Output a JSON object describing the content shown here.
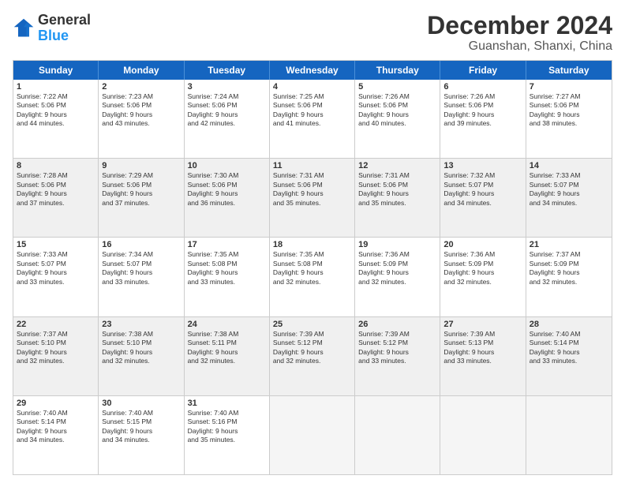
{
  "logo": {
    "line1": "General",
    "line2": "Blue"
  },
  "header": {
    "month": "December 2024",
    "location": "Guanshan, Shanxi, China"
  },
  "days": [
    "Sunday",
    "Monday",
    "Tuesday",
    "Wednesday",
    "Thursday",
    "Friday",
    "Saturday"
  ],
  "weeks": [
    [
      {
        "num": "1",
        "lines": [
          "Sunrise: 7:22 AM",
          "Sunset: 5:06 PM",
          "Daylight: 9 hours",
          "and 44 minutes."
        ]
      },
      {
        "num": "2",
        "lines": [
          "Sunrise: 7:23 AM",
          "Sunset: 5:06 PM",
          "Daylight: 9 hours",
          "and 43 minutes."
        ]
      },
      {
        "num": "3",
        "lines": [
          "Sunrise: 7:24 AM",
          "Sunset: 5:06 PM",
          "Daylight: 9 hours",
          "and 42 minutes."
        ]
      },
      {
        "num": "4",
        "lines": [
          "Sunrise: 7:25 AM",
          "Sunset: 5:06 PM",
          "Daylight: 9 hours",
          "and 41 minutes."
        ]
      },
      {
        "num": "5",
        "lines": [
          "Sunrise: 7:26 AM",
          "Sunset: 5:06 PM",
          "Daylight: 9 hours",
          "and 40 minutes."
        ]
      },
      {
        "num": "6",
        "lines": [
          "Sunrise: 7:26 AM",
          "Sunset: 5:06 PM",
          "Daylight: 9 hours",
          "and 39 minutes."
        ]
      },
      {
        "num": "7",
        "lines": [
          "Sunrise: 7:27 AM",
          "Sunset: 5:06 PM",
          "Daylight: 9 hours",
          "and 38 minutes."
        ]
      }
    ],
    [
      {
        "num": "8",
        "lines": [
          "Sunrise: 7:28 AM",
          "Sunset: 5:06 PM",
          "Daylight: 9 hours",
          "and 37 minutes."
        ]
      },
      {
        "num": "9",
        "lines": [
          "Sunrise: 7:29 AM",
          "Sunset: 5:06 PM",
          "Daylight: 9 hours",
          "and 37 minutes."
        ]
      },
      {
        "num": "10",
        "lines": [
          "Sunrise: 7:30 AM",
          "Sunset: 5:06 PM",
          "Daylight: 9 hours",
          "and 36 minutes."
        ]
      },
      {
        "num": "11",
        "lines": [
          "Sunrise: 7:31 AM",
          "Sunset: 5:06 PM",
          "Daylight: 9 hours",
          "and 35 minutes."
        ]
      },
      {
        "num": "12",
        "lines": [
          "Sunrise: 7:31 AM",
          "Sunset: 5:06 PM",
          "Daylight: 9 hours",
          "and 35 minutes."
        ]
      },
      {
        "num": "13",
        "lines": [
          "Sunrise: 7:32 AM",
          "Sunset: 5:07 PM",
          "Daylight: 9 hours",
          "and 34 minutes."
        ]
      },
      {
        "num": "14",
        "lines": [
          "Sunrise: 7:33 AM",
          "Sunset: 5:07 PM",
          "Daylight: 9 hours",
          "and 34 minutes."
        ]
      }
    ],
    [
      {
        "num": "15",
        "lines": [
          "Sunrise: 7:33 AM",
          "Sunset: 5:07 PM",
          "Daylight: 9 hours",
          "and 33 minutes."
        ]
      },
      {
        "num": "16",
        "lines": [
          "Sunrise: 7:34 AM",
          "Sunset: 5:07 PM",
          "Daylight: 9 hours",
          "and 33 minutes."
        ]
      },
      {
        "num": "17",
        "lines": [
          "Sunrise: 7:35 AM",
          "Sunset: 5:08 PM",
          "Daylight: 9 hours",
          "and 33 minutes."
        ]
      },
      {
        "num": "18",
        "lines": [
          "Sunrise: 7:35 AM",
          "Sunset: 5:08 PM",
          "Daylight: 9 hours",
          "and 32 minutes."
        ]
      },
      {
        "num": "19",
        "lines": [
          "Sunrise: 7:36 AM",
          "Sunset: 5:09 PM",
          "Daylight: 9 hours",
          "and 32 minutes."
        ]
      },
      {
        "num": "20",
        "lines": [
          "Sunrise: 7:36 AM",
          "Sunset: 5:09 PM",
          "Daylight: 9 hours",
          "and 32 minutes."
        ]
      },
      {
        "num": "21",
        "lines": [
          "Sunrise: 7:37 AM",
          "Sunset: 5:09 PM",
          "Daylight: 9 hours",
          "and 32 minutes."
        ]
      }
    ],
    [
      {
        "num": "22",
        "lines": [
          "Sunrise: 7:37 AM",
          "Sunset: 5:10 PM",
          "Daylight: 9 hours",
          "and 32 minutes."
        ]
      },
      {
        "num": "23",
        "lines": [
          "Sunrise: 7:38 AM",
          "Sunset: 5:10 PM",
          "Daylight: 9 hours",
          "and 32 minutes."
        ]
      },
      {
        "num": "24",
        "lines": [
          "Sunrise: 7:38 AM",
          "Sunset: 5:11 PM",
          "Daylight: 9 hours",
          "and 32 minutes."
        ]
      },
      {
        "num": "25",
        "lines": [
          "Sunrise: 7:39 AM",
          "Sunset: 5:12 PM",
          "Daylight: 9 hours",
          "and 32 minutes."
        ]
      },
      {
        "num": "26",
        "lines": [
          "Sunrise: 7:39 AM",
          "Sunset: 5:12 PM",
          "Daylight: 9 hours",
          "and 33 minutes."
        ]
      },
      {
        "num": "27",
        "lines": [
          "Sunrise: 7:39 AM",
          "Sunset: 5:13 PM",
          "Daylight: 9 hours",
          "and 33 minutes."
        ]
      },
      {
        "num": "28",
        "lines": [
          "Sunrise: 7:40 AM",
          "Sunset: 5:14 PM",
          "Daylight: 9 hours",
          "and 33 minutes."
        ]
      }
    ],
    [
      {
        "num": "29",
        "lines": [
          "Sunrise: 7:40 AM",
          "Sunset: 5:14 PM",
          "Daylight: 9 hours",
          "and 34 minutes."
        ]
      },
      {
        "num": "30",
        "lines": [
          "Sunrise: 7:40 AM",
          "Sunset: 5:15 PM",
          "Daylight: 9 hours",
          "and 34 minutes."
        ]
      },
      {
        "num": "31",
        "lines": [
          "Sunrise: 7:40 AM",
          "Sunset: 5:16 PM",
          "Daylight: 9 hours",
          "and 35 minutes."
        ]
      },
      null,
      null,
      null,
      null
    ]
  ]
}
